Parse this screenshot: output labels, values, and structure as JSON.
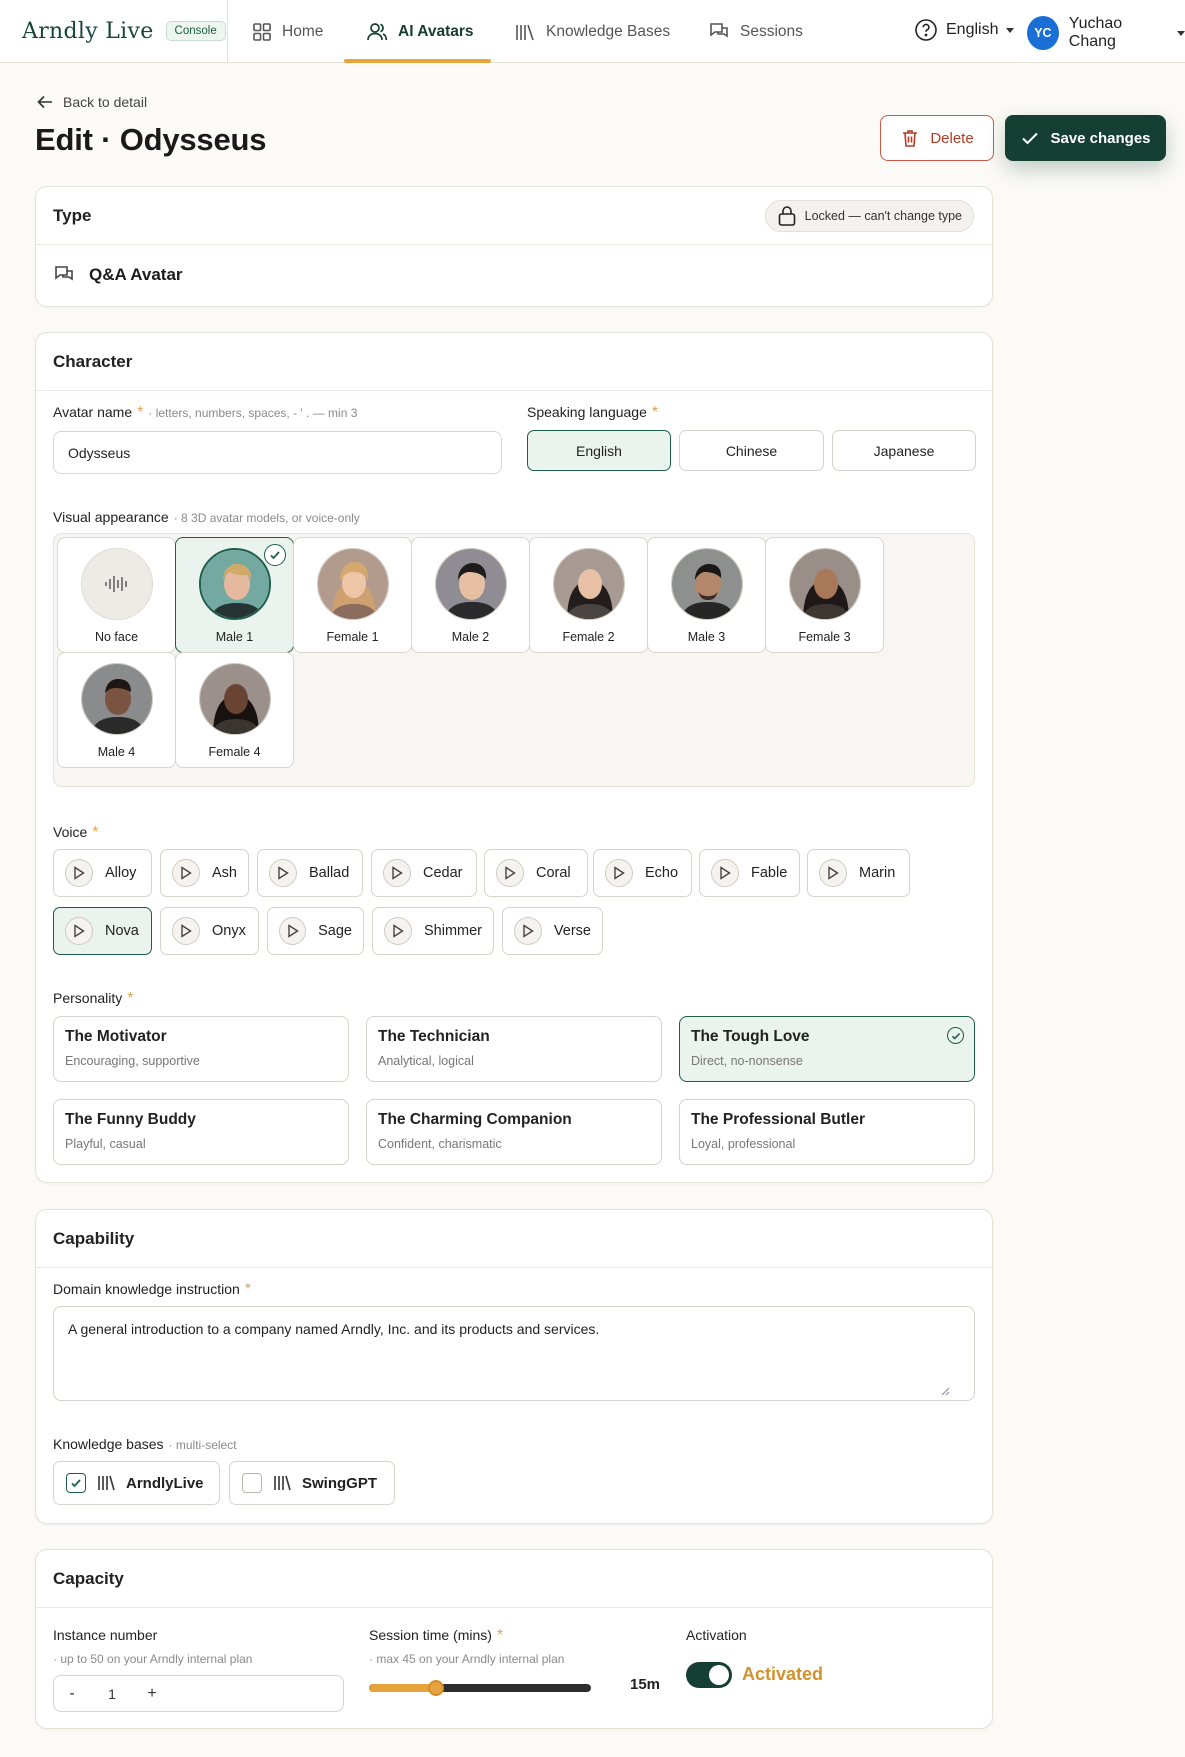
{
  "brand": {
    "logo": "Arndly Live",
    "badge": "Console"
  },
  "nav": [
    {
      "label": "Home",
      "icon": "grid-icon"
    },
    {
      "label": "AI Avatars",
      "icon": "users-icon"
    },
    {
      "label": "Knowledge Bases",
      "icon": "library-icon"
    },
    {
      "label": "Sessions",
      "icon": "chat-icon"
    }
  ],
  "header": {
    "language": "English",
    "user_initials": "YC",
    "user_name": "Yuchao Chang"
  },
  "page": {
    "back_label": "Back to detail",
    "title": "Edit · Odysseus",
    "delete_label": "Delete",
    "save_label": "Save changes"
  },
  "type_card": {
    "heading": "Type",
    "locked_label": "Locked — can't change type",
    "type_name": "Q&A Avatar"
  },
  "character": {
    "heading": "Character",
    "name_label": "Avatar name",
    "name_hint": "· letters, numbers, spaces, - ' . — min 3",
    "name_value": "Odysseus",
    "speaking_label": "Speaking language",
    "languages": [
      "English",
      "Chinese",
      "Japanese"
    ],
    "selected_language": "English",
    "visual_label": "Visual appearance",
    "visual_hint": "· 8 3D avatar models, or voice-only",
    "faces": [
      "No face",
      "Male 1",
      "Female 1",
      "Male 2",
      "Female 2",
      "Male 3",
      "Female 3",
      "Male 4",
      "Female 4"
    ],
    "selected_face": "Male 1",
    "voice_label": "Voice",
    "voices": [
      "Alloy",
      "Ash",
      "Ballad",
      "Cedar",
      "Coral",
      "Echo",
      "Fable",
      "Marin",
      "Nova",
      "Onyx",
      "Sage",
      "Shimmer",
      "Verse"
    ],
    "selected_voice": "Nova",
    "personality_label": "Personality",
    "personalities": [
      {
        "title": "The Motivator",
        "desc": "Encouraging, supportive"
      },
      {
        "title": "The Technician",
        "desc": "Analytical, logical"
      },
      {
        "title": "The Tough Love",
        "desc": "Direct, no-nonsense"
      },
      {
        "title": "The Funny Buddy",
        "desc": "Playful, casual"
      },
      {
        "title": "The Charming Companion",
        "desc": "Confident, charismatic"
      },
      {
        "title": "The Professional Butler",
        "desc": "Loyal, professional"
      }
    ],
    "selected_personality": "The Tough Love"
  },
  "capability": {
    "heading": "Capability",
    "domain_label": "Domain knowledge instruction",
    "domain_value": "A general introduction to a company named Arndly, Inc. and its products and services.",
    "kb_label": "Knowledge bases",
    "kb_hint": "· multi-select",
    "kbs": [
      {
        "name": "ArndlyLive",
        "checked": true
      },
      {
        "name": "SwingGPT",
        "checked": false
      }
    ]
  },
  "capacity": {
    "heading": "Capacity",
    "instance_label": "Instance number",
    "instance_hint": "· up to 50 on your Arndly internal plan",
    "instance_value": "1",
    "minus": "-",
    "plus": "+",
    "session_label": "Session time (mins)",
    "session_hint": "· max 45 on your Arndly internal plan",
    "session_value": "15m",
    "session_fraction": 0.3,
    "activation_label": "Activation",
    "activation_value": "Activated"
  },
  "colors": {
    "primary": "#153f33",
    "accent": "#e8a53c",
    "danger": "#b43b26",
    "selected_bg": "#eaf3ee"
  }
}
